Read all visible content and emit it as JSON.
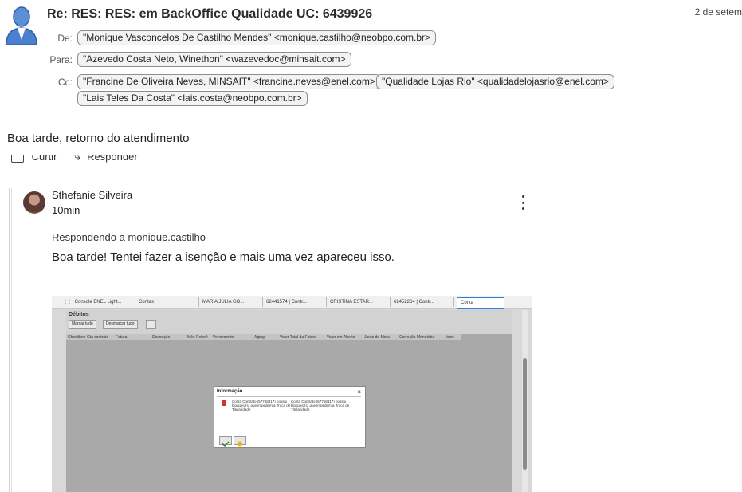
{
  "email": {
    "subject": "Re: RES: RES: em BackOffice Qualidade UC: 6439926",
    "date": "2 de setem",
    "labels": {
      "from": "De:",
      "to": "Para:",
      "cc": "Cc:"
    },
    "from": "\"Monique Vasconcelos De Castilho Mendes\" <monique.castilho@neobpo.com.br>",
    "to": "\"Azevedo Costa Neto, Winethon\" <wazevedoc@minsait.com>",
    "cc": [
      "\"Francine De Oliveira Neves, MINSAIT\" <francine.neves@enel.com>",
      "\"Qualidade Lojas Rio\" <qualidadelojasrio@enel.com>",
      "\"Lais Teles Da Costa\" <lais.costa@neobpo.com.br>"
    ],
    "body": "Boa tarde, retorno do atendimento"
  },
  "actions": {
    "like": "Curtir",
    "reply": "Responder"
  },
  "post": {
    "author": "Sthefanie Silveira",
    "time_ago": "10min",
    "reply_prefix": "Respondendo a",
    "reply_to": "monique.castilho",
    "message": "Boa tarde! Tentei fazer a isenção e mais uma vez apareceu isso."
  },
  "screenshot": {
    "tabs": [
      "Console ENEL Light...",
      "Contas",
      "MARIA JULIA GO...",
      "62441574 | Contr...",
      "CRISTINA ESTAR...",
      "62452264 | Contr...",
      "Conta"
    ],
    "section_title": "Débitos",
    "buttons": [
      "Marcar tudo",
      "Desmarcar tudo"
    ],
    "columns": [
      "Checkbox",
      "Cta contrato",
      "Fatura",
      "Descrição",
      "Mês Referê",
      "Vencimento",
      "Aging",
      "Valor Total da Fatura",
      "Valor em Aberto",
      "Juros de Mora",
      "Correção Monetária",
      "Itens"
    ],
    "dialog": {
      "title": "Informação",
      "close": "×",
      "message_left": "Conta Contrato (57758417) possui bloqueio(s) que impedem a Troca de Titularidade",
      "message_right": "Conta Contrato (57758417) possui bloqueio(s) que impedem a Troca de Titularidade"
    }
  },
  "colors": {
    "chip_border": "#8e8e8e",
    "avatar_blue": "#3a78c9",
    "tab_active_border": "#2d7fd3"
  }
}
